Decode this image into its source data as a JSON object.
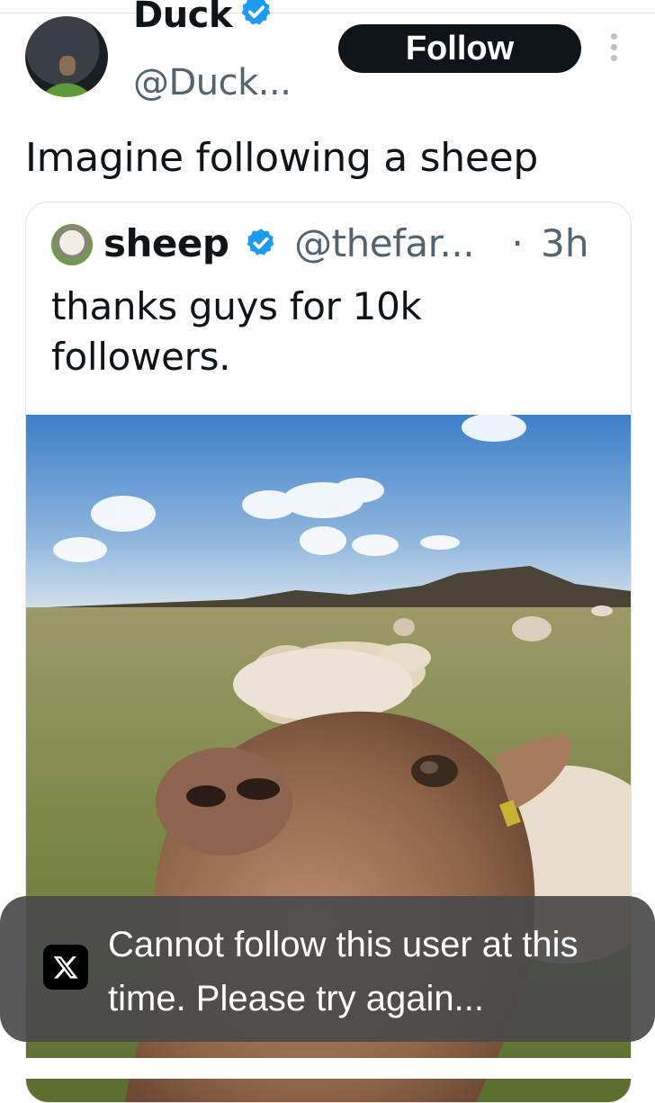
{
  "author": {
    "display_name": "Duck",
    "handle": "@Duck...",
    "verified": true
  },
  "follow_button": {
    "label": "Follow"
  },
  "tweet": {
    "text": "Imagine following a sheep"
  },
  "quoted_tweet": {
    "display_name": "sheep",
    "handle": "@thefar...",
    "separator": "·",
    "time": "3h",
    "verified": true,
    "text": "thanks guys for 10k followers."
  },
  "toast": {
    "icon": "x-logo-icon",
    "message": "Cannot follow this user at this time. Please try again..."
  },
  "colors": {
    "verified_blue": "#1d9bf0",
    "follow_button_bg": "#0f1419",
    "secondary_text": "#536471",
    "toast_bg": "#4a4a4a"
  }
}
